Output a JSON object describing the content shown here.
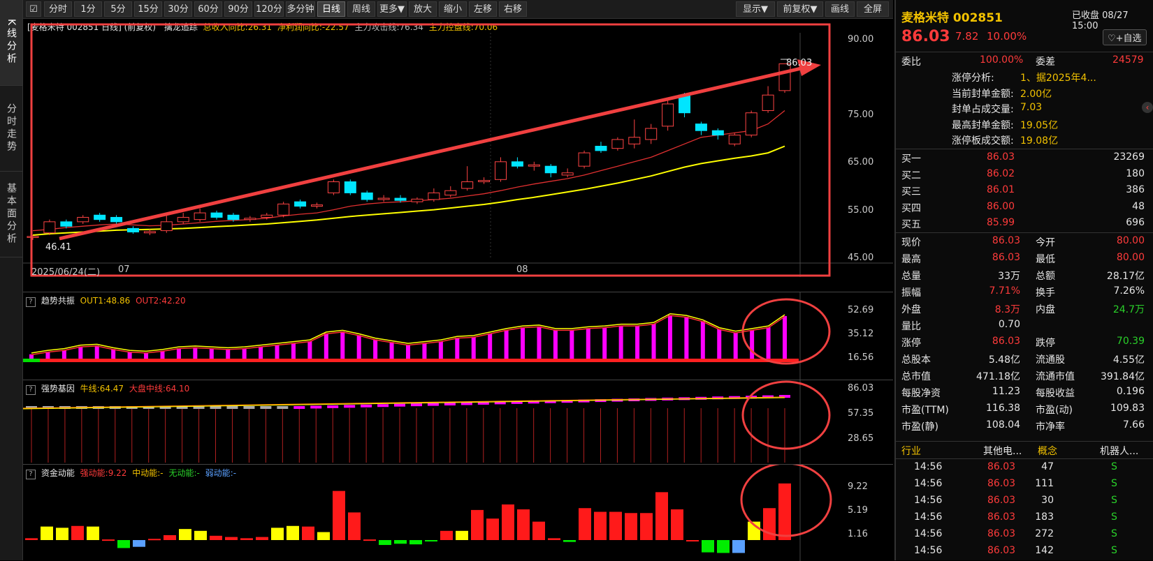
{
  "left_tabs": [
    "K线分析",
    "分时走势",
    "基本面分析"
  ],
  "toolbar": {
    "buttons": [
      "分时",
      "1分",
      "5分",
      "15分",
      "30分",
      "60分",
      "90分",
      "120分",
      "多分钟",
      "日线",
      "周线",
      "更多▼",
      "放大",
      "缩小",
      "左移",
      "右移"
    ],
    "right_buttons": [
      "显示▼",
      "前复权▼",
      "画线",
      "全屏"
    ],
    "active": "日线"
  },
  "main_chart": {
    "header": "[麦格米特 002851 日线] (前复权)",
    "indicator_name": "擒龙追踪",
    "ind1": "总收入同比:26.31",
    "ind2": "净利润同比:-22.57",
    "ind3": "主力攻击线:76.34",
    "ind4": "主力控盘线:70.06",
    "y_ticks": [
      "90.00",
      "75.00",
      "65.00",
      "55.00",
      "45.00"
    ],
    "x_labels": [
      "2025/06/24(二)",
      "07",
      "08"
    ],
    "low_label": "46.41",
    "high_label": "86.03"
  },
  "chart_data": [
    {
      "type": "candlestick",
      "title": "麦格米特 002851 日线",
      "ylim": [
        42,
        93
      ],
      "candles": [
        {
          "o": 47.0,
          "c": 47.2,
          "h": 47.5,
          "l": 46.41
        },
        {
          "o": 48.0,
          "c": 50.5,
          "h": 51.0,
          "l": 47.5
        },
        {
          "o": 50.5,
          "c": 49.5,
          "h": 51.0,
          "l": 49.0
        },
        {
          "o": 50.5,
          "c": 51.5,
          "h": 52.0,
          "l": 50.0
        },
        {
          "o": 52.0,
          "c": 51.0,
          "h": 52.5,
          "l": 50.5
        },
        {
          "o": 51.5,
          "c": 50.5,
          "h": 52.0,
          "l": 50.0
        },
        {
          "o": 49.0,
          "c": 48.2,
          "h": 49.5,
          "l": 47.8
        },
        {
          "o": 48.0,
          "c": 48.3,
          "h": 48.8,
          "l": 47.5
        },
        {
          "o": 48.5,
          "c": 50.5,
          "h": 52.0,
          "l": 48.0
        },
        {
          "o": 50.5,
          "c": 51.5,
          "h": 52.5,
          "l": 50.0
        },
        {
          "o": 51.0,
          "c": 52.5,
          "h": 53.5,
          "l": 50.5
        },
        {
          "o": 52.5,
          "c": 51.5,
          "h": 53.0,
          "l": 51.0
        },
        {
          "o": 52.0,
          "c": 51.0,
          "h": 52.5,
          "l": 50.5
        },
        {
          "o": 51.0,
          "c": 51.3,
          "h": 51.8,
          "l": 50.5
        },
        {
          "o": 51.5,
          "c": 52.0,
          "h": 52.5,
          "l": 51.0
        },
        {
          "o": 52.0,
          "c": 54.5,
          "h": 55.0,
          "l": 51.5
        },
        {
          "o": 55.0,
          "c": 54.0,
          "h": 55.5,
          "l": 53.5
        },
        {
          "o": 54.0,
          "c": 54.3,
          "h": 54.8,
          "l": 53.5
        },
        {
          "o": 57.0,
          "c": 59.5,
          "h": 60.0,
          "l": 56.5
        },
        {
          "o": 59.5,
          "c": 57.0,
          "h": 60.0,
          "l": 56.5
        },
        {
          "o": 57.0,
          "c": 55.5,
          "h": 57.5,
          "l": 55.0
        },
        {
          "o": 55.5,
          "c": 55.8,
          "h": 56.5,
          "l": 55.0
        },
        {
          "o": 55.8,
          "c": 55.3,
          "h": 56.5,
          "l": 54.8
        },
        {
          "o": 55.0,
          "c": 55.6,
          "h": 56.0,
          "l": 54.5
        },
        {
          "o": 55.5,
          "c": 57.0,
          "h": 58.0,
          "l": 55.0
        },
        {
          "o": 56.5,
          "c": 57.5,
          "h": 58.5,
          "l": 56.0
        },
        {
          "o": 58.0,
          "c": 59.5,
          "h": 63.0,
          "l": 57.5
        },
        {
          "o": 59.5,
          "c": 59.8,
          "h": 60.5,
          "l": 59.0
        },
        {
          "o": 60.0,
          "c": 64.0,
          "h": 65.0,
          "l": 59.5
        },
        {
          "o": 64.0,
          "c": 63.0,
          "h": 65.0,
          "l": 62.5
        },
        {
          "o": 63.0,
          "c": 63.3,
          "h": 64.0,
          "l": 62.0
        },
        {
          "o": 63.0,
          "c": 61.5,
          "h": 63.5,
          "l": 60.5
        },
        {
          "o": 61.0,
          "c": 61.5,
          "h": 62.5,
          "l": 60.5
        },
        {
          "o": 63.0,
          "c": 66.0,
          "h": 66.5,
          "l": 62.5
        },
        {
          "o": 67.5,
          "c": 66.5,
          "h": 68.5,
          "l": 66.0
        },
        {
          "o": 67.0,
          "c": 69.0,
          "h": 69.5,
          "l": 66.5
        },
        {
          "o": 68.0,
          "c": 69.5,
          "h": 73.5,
          "l": 67.0
        },
        {
          "o": 69.0,
          "c": 71.5,
          "h": 72.5,
          "l": 68.0
        },
        {
          "o": 72.0,
          "c": 77.0,
          "h": 78.0,
          "l": 71.0
        },
        {
          "o": 79.0,
          "c": 75.0,
          "h": 79.5,
          "l": 74.0
        },
        {
          "o": 72.5,
          "c": 71.0,
          "h": 73.0,
          "l": 70.0
        },
        {
          "o": 71.0,
          "c": 70.0,
          "h": 71.5,
          "l": 69.0
        },
        {
          "o": 68.0,
          "c": 70.0,
          "h": 70.5,
          "l": 67.5
        },
        {
          "o": 70.0,
          "c": 75.0,
          "h": 75.5,
          "l": 69.5
        },
        {
          "o": 75.5,
          "c": 79.0,
          "h": 81.0,
          "l": 75.0
        },
        {
          "o": 80.0,
          "c": 86.03,
          "h": 86.03,
          "l": 79.5
        }
      ],
      "ma_red": [
        48.5,
        48.8,
        49.2,
        49.5,
        49.8,
        50.0,
        49.8,
        49.6,
        49.7,
        50.0,
        50.3,
        50.6,
        50.8,
        51.0,
        51.3,
        51.8,
        52.2,
        52.5,
        53.2,
        54.0,
        54.5,
        54.8,
        55.0,
        55.2,
        55.5,
        55.8,
        56.3,
        56.8,
        57.5,
        58.3,
        59.0,
        59.6,
        60.2,
        61.0,
        62.0,
        63.0,
        64.0,
        65.0,
        66.5,
        68.0,
        69.5,
        70.0,
        70.5,
        71.0,
        72.5,
        75.5
      ],
      "ma_yellow": [
        47.5,
        47.8,
        48.0,
        48.2,
        48.4,
        48.6,
        48.7,
        48.8,
        48.9,
        49.0,
        49.2,
        49.4,
        49.6,
        49.8,
        50.0,
        50.3,
        50.6,
        50.9,
        51.3,
        51.7,
        52.0,
        52.3,
        52.6,
        52.9,
        53.2,
        53.6,
        54.0,
        54.4,
        54.9,
        55.5,
        56.0,
        56.6,
        57.2,
        57.8,
        58.5,
        59.2,
        60.0,
        60.8,
        61.8,
        62.8,
        63.6,
        64.2,
        64.8,
        65.3,
        66.0,
        67.5
      ]
    },
    {
      "type": "bar",
      "title": "趋势共振",
      "series": [
        {
          "name": "OUT1",
          "last": 48.86
        },
        {
          "name": "OUT2",
          "last": 42.2
        }
      ],
      "ylim": [
        0,
        60
      ],
      "values": [
        5,
        8,
        10,
        14,
        15,
        11,
        8,
        7,
        9,
        12,
        13,
        12,
        11,
        12,
        14,
        16,
        18,
        20,
        29,
        31,
        27,
        22,
        19,
        16,
        18,
        20,
        24,
        25,
        29,
        33,
        36,
        37,
        33,
        33,
        35,
        36,
        38,
        38,
        40,
        50,
        48,
        43,
        34,
        30,
        33,
        36,
        48.86
      ]
    },
    {
      "type": "bar",
      "title": "强势基因",
      "series": [
        {
          "name": "牛线",
          "last": 64.47
        },
        {
          "name": "大盘中线",
          "last": 64.1
        }
      ],
      "ylim": [
        10,
        95
      ]
    },
    {
      "type": "bar",
      "title": "资金动能",
      "series": [
        {
          "name": "强动能",
          "last": 9.22
        },
        {
          "name": "中动能",
          "last": "-"
        },
        {
          "name": "无动能",
          "last": "-"
        },
        {
          "name": "弱动能",
          "last": "-"
        }
      ],
      "ylim": [
        -2.5,
        10
      ],
      "values": [
        0.3,
        2.2,
        2.0,
        2.3,
        2.2,
        0.1,
        -1.3,
        -1.1,
        0.2,
        0.8,
        1.8,
        1.5,
        0.7,
        0.5,
        0.3,
        0.5,
        2.0,
        2.3,
        2.2,
        1.3,
        8.0,
        4.5,
        0.1,
        -0.8,
        -0.6,
        -0.7,
        -0.2,
        1.5,
        1.5,
        4.9,
        3.5,
        5.8,
        5.0,
        3.0,
        0.3,
        -0.3,
        5.2,
        4.6,
        4.6,
        4.4,
        4.4,
        7.8,
        5.0,
        0,
        -2.0,
        -2.1,
        -2.1,
        3.0,
        5.2,
        9.22
      ]
    }
  ],
  "sub_panels": {
    "p1": {
      "name": "趋势共振",
      "l1": "OUT1:48.86",
      "l2": "OUT2:42.20",
      "y_ticks": [
        "52.69",
        "35.12",
        "16.56"
      ]
    },
    "p2": {
      "name": "强势基因",
      "l1": "牛线:64.47",
      "l2": "大盘中线:64.10",
      "y_ticks": [
        "86.03",
        "57.35",
        "28.65"
      ]
    },
    "p3": {
      "name": "资金动能",
      "l1": "强动能:9.22",
      "l2": "中动能:-",
      "l3": "无动能:-",
      "l4": "弱动能:-",
      "y_ticks": [
        "9.22",
        "5.19",
        "1.16"
      ]
    }
  },
  "quote": {
    "name": "麦格米特 002851",
    "status": "已收盘 08/27 15:00",
    "price": "86.03",
    "change": "7.82",
    "pct": "10.00%",
    "add_fav": "+自选",
    "weibi_label": "委比",
    "weibi": "100.00%",
    "weicha_label": "委差",
    "weicha": "24579",
    "limit_rows": [
      {
        "k": "涨停分析:",
        "v": "1、据2025年4..."
      },
      {
        "k": "当前封单金额:",
        "v": "2.00亿"
      },
      {
        "k": "封单占成交量:",
        "v": "7.03"
      },
      {
        "k": "最高封单金额:",
        "v": "19.05亿"
      },
      {
        "k": "涨停板成交额:",
        "v": "19.08亿"
      }
    ],
    "bids": [
      {
        "k": "买一",
        "p": "86.03",
        "v": "23269"
      },
      {
        "k": "买二",
        "p": "86.02",
        "v": "180"
      },
      {
        "k": "买三",
        "p": "86.01",
        "v": "386"
      },
      {
        "k": "买四",
        "p": "86.00",
        "v": "48"
      },
      {
        "k": "买五",
        "p": "85.99",
        "v": "696"
      }
    ],
    "stats": [
      {
        "k1": "现价",
        "v1": "86.03",
        "c1": "red",
        "k2": "今开",
        "v2": "80.00",
        "c2": "red"
      },
      {
        "k1": "最高",
        "v1": "86.03",
        "c1": "red",
        "k2": "最低",
        "v2": "80.00",
        "c2": "red"
      },
      {
        "k1": "总量",
        "v1": "33万",
        "c1": "white",
        "k2": "总额",
        "v2": "28.17亿",
        "c2": "white"
      },
      {
        "k1": "振幅",
        "v1": "7.71%",
        "c1": "red",
        "k2": "换手",
        "v2": "7.26%",
        "c2": "white"
      },
      {
        "k1": "外盘",
        "v1": "8.3万",
        "c1": "red",
        "k2": "内盘",
        "v2": "24.7万",
        "c2": "green"
      },
      {
        "k1": "量比",
        "v1": "0.70",
        "c1": "white",
        "k2": "",
        "v2": "",
        "c2": "white"
      },
      {
        "k1": "涨停",
        "v1": "86.03",
        "c1": "red",
        "k2": "跌停",
        "v2": "70.39",
        "c2": "green"
      },
      {
        "k1": "总股本",
        "v1": "5.48亿",
        "c1": "white",
        "k2": "流通股",
        "v2": "4.55亿",
        "c2": "white"
      },
      {
        "k1": "总市值",
        "v1": "471.18亿",
        "c1": "white",
        "k2": "流通市值",
        "v2": "391.84亿",
        "c2": "white"
      },
      {
        "k1": "每股净资",
        "v1": "11.23",
        "c1": "white",
        "k2": "每股收益",
        "v2": "0.196",
        "c2": "white"
      },
      {
        "k1": "市盈(TTM)",
        "v1": "116.38",
        "c1": "white",
        "k2": "市盈(动)",
        "v2": "109.83",
        "c2": "white"
      },
      {
        "k1": "市盈(静)",
        "v1": "108.04",
        "c1": "white",
        "k2": "市净率",
        "v2": "7.66",
        "c2": "white"
      }
    ],
    "industry_label": "行业",
    "industry": "其他电...",
    "concept_label": "概念",
    "concept": "机器人...",
    "ticks": [
      {
        "t": "14:56",
        "p": "86.03",
        "v": "47",
        "d": "S"
      },
      {
        "t": "14:56",
        "p": "86.03",
        "v": "111",
        "d": "S"
      },
      {
        "t": "14:56",
        "p": "86.03",
        "v": "30",
        "d": "S"
      },
      {
        "t": "14:56",
        "p": "86.03",
        "v": "183",
        "d": "S"
      },
      {
        "t": "14:56",
        "p": "86.03",
        "v": "272",
        "d": "S"
      },
      {
        "t": "14:56",
        "p": "86.03",
        "v": "142",
        "d": "S"
      }
    ]
  }
}
